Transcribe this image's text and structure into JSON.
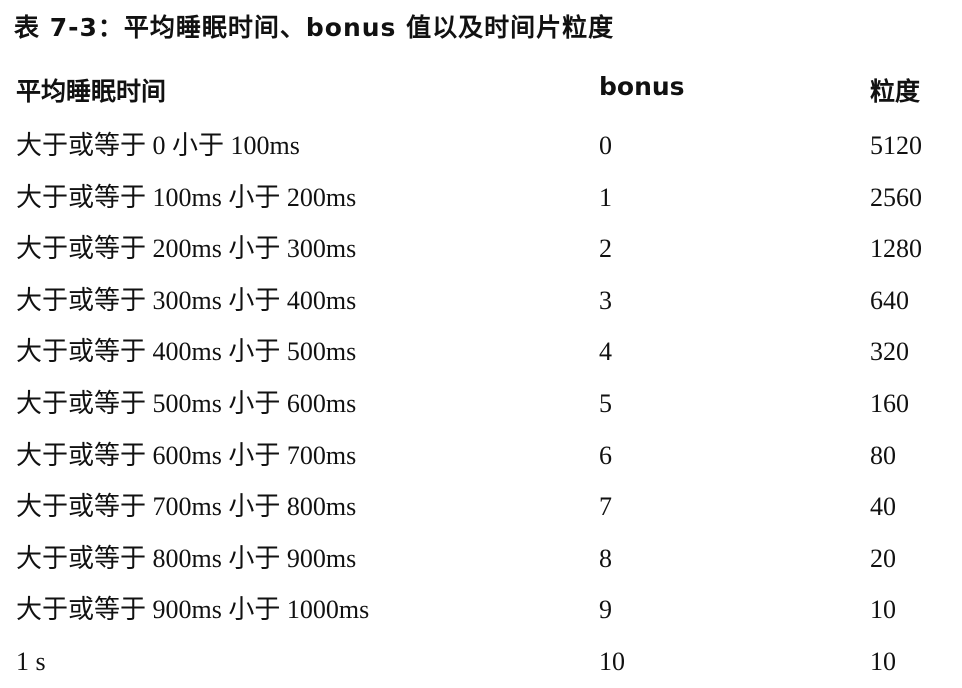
{
  "caption": "表 7-3：平均睡眠时间、bonus 值以及时间片粒度",
  "table": {
    "headers": [
      "平均睡眠时间",
      "bonus",
      "粒度"
    ],
    "rows": [
      [
        "大于或等于 0 小于 100ms",
        "0",
        "5120"
      ],
      [
        "大于或等于 100ms 小于 200ms",
        "1",
        "2560"
      ],
      [
        "大于或等于 200ms 小于 300ms",
        "2",
        "1280"
      ],
      [
        "大于或等于 300ms 小于 400ms",
        "3",
        "640"
      ],
      [
        "大于或等于 400ms 小于 500ms",
        "4",
        "320"
      ],
      [
        "大于或等于 500ms 小于 600ms",
        "5",
        "160"
      ],
      [
        "大于或等于 600ms 小于 700ms",
        "6",
        "80"
      ],
      [
        "大于或等于 700ms 小于 800ms",
        "7",
        "40"
      ],
      [
        "大于或等于 800ms 小于 900ms",
        "8",
        "20"
      ],
      [
        "大于或等于 900ms 小于 1000ms",
        "9",
        "10"
      ],
      [
        "1 s",
        "10",
        "10"
      ]
    ]
  }
}
